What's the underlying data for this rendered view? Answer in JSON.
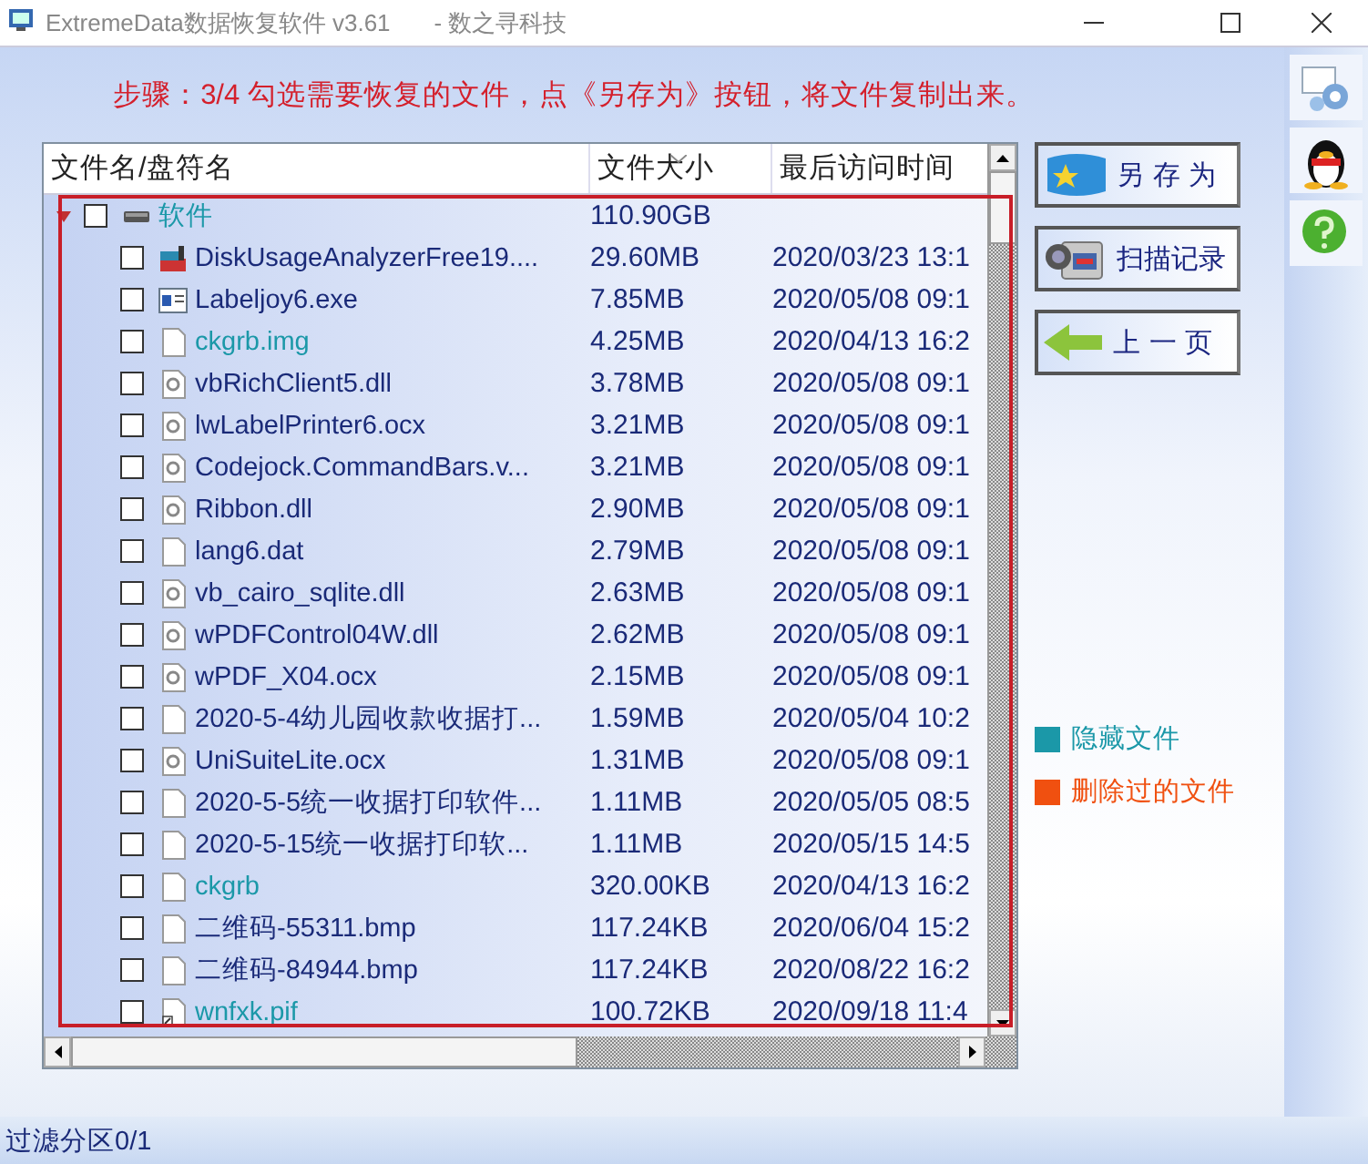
{
  "window": {
    "title": "ExtremeData数据恢复软件 v3.61",
    "subtitle": "- 数之寻科技"
  },
  "step_text": "步骤：3/4 勾选需要恢复的文件，点《另存为》按钮，将文件复制出来。",
  "table": {
    "columns": [
      "文件名/盘符名",
      "文件大小",
      "最后访问时间"
    ],
    "rows": [
      {
        "name": "软件",
        "size": "110.90GB",
        "date": "",
        "kind": "drive",
        "hidden": true,
        "checked": false,
        "expanded": true,
        "children": [
          {
            "name": "DiskUsageAnalyzerFree19....",
            "size": "29.60MB",
            "date": "2020/03/23 13:1",
            "kind": "app",
            "hidden": false,
            "checked": false
          },
          {
            "name": "Labeljoy6.exe",
            "size": "7.85MB",
            "date": "2020/05/08 09:1",
            "kind": "window",
            "hidden": false,
            "checked": false
          },
          {
            "name": "ckgrb.img",
            "size": "4.25MB",
            "date": "2020/04/13 16:2",
            "kind": "blank",
            "hidden": true,
            "checked": false
          },
          {
            "name": "vbRichClient5.dll",
            "size": "3.78MB",
            "date": "2020/05/08 09:1",
            "kind": "gear",
            "hidden": false,
            "checked": false
          },
          {
            "name": "lwLabelPrinter6.ocx",
            "size": "3.21MB",
            "date": "2020/05/08 09:1",
            "kind": "gear",
            "hidden": false,
            "checked": false
          },
          {
            "name": "Codejock.CommandBars.v...",
            "size": "3.21MB",
            "date": "2020/05/08 09:1",
            "kind": "gear",
            "hidden": false,
            "checked": false
          },
          {
            "name": "Ribbon.dll",
            "size": "2.90MB",
            "date": "2020/05/08 09:1",
            "kind": "gear",
            "hidden": false,
            "checked": false
          },
          {
            "name": "lang6.dat",
            "size": "2.79MB",
            "date": "2020/05/08 09:1",
            "kind": "blank",
            "hidden": false,
            "checked": false
          },
          {
            "name": "vb_cairo_sqlite.dll",
            "size": "2.63MB",
            "date": "2020/05/08 09:1",
            "kind": "gear",
            "hidden": false,
            "checked": false
          },
          {
            "name": "wPDFControl04W.dll",
            "size": "2.62MB",
            "date": "2020/05/08 09:1",
            "kind": "gear",
            "hidden": false,
            "checked": false
          },
          {
            "name": "wPDF_X04.ocx",
            "size": "2.15MB",
            "date": "2020/05/08 09:1",
            "kind": "gear",
            "hidden": false,
            "checked": false
          },
          {
            "name": "2020-5-4幼儿园收款收据打...",
            "size": "1.59MB",
            "date": "2020/05/04 10:2",
            "kind": "blank",
            "hidden": false,
            "checked": false
          },
          {
            "name": "UniSuiteLite.ocx",
            "size": "1.31MB",
            "date": "2020/05/08 09:1",
            "kind": "gear",
            "hidden": false,
            "checked": false
          },
          {
            "name": "2020-5-5统一收据打印软件...",
            "size": "1.11MB",
            "date": "2020/05/05 08:5",
            "kind": "blank",
            "hidden": false,
            "checked": false
          },
          {
            "name": "2020-5-15统一收据打印软...",
            "size": "1.11MB",
            "date": "2020/05/15 14:5",
            "kind": "blank",
            "hidden": false,
            "checked": false
          },
          {
            "name": "ckgrb",
            "size": "320.00KB",
            "date": "2020/04/13 16:2",
            "kind": "blank",
            "hidden": true,
            "checked": false
          },
          {
            "name": "二维码-55311.bmp",
            "size": "117.24KB",
            "date": "2020/06/04 15:2",
            "kind": "blank",
            "hidden": false,
            "checked": false
          },
          {
            "name": "二维码-84944.bmp",
            "size": "117.24KB",
            "date": "2020/08/22 16:2",
            "kind": "blank",
            "hidden": false,
            "checked": false
          },
          {
            "name": "wnfxk.pif",
            "size": "100.72KB",
            "date": "2020/09/18 11:4",
            "kind": "shortcut",
            "hidden": true,
            "checked": false
          }
        ]
      }
    ]
  },
  "buttons": [
    {
      "label": "另 存 为",
      "kind": "save"
    },
    {
      "label": "扫描记录",
      "kind": "camera"
    },
    {
      "label": "上 一 页",
      "kind": "back"
    }
  ],
  "legend": [
    {
      "label": "隐藏文件",
      "color": "#1b98a8"
    },
    {
      "label": "删除过的文件",
      "color": "#f05010"
    }
  ],
  "status_bar": "过滤分区0/1"
}
